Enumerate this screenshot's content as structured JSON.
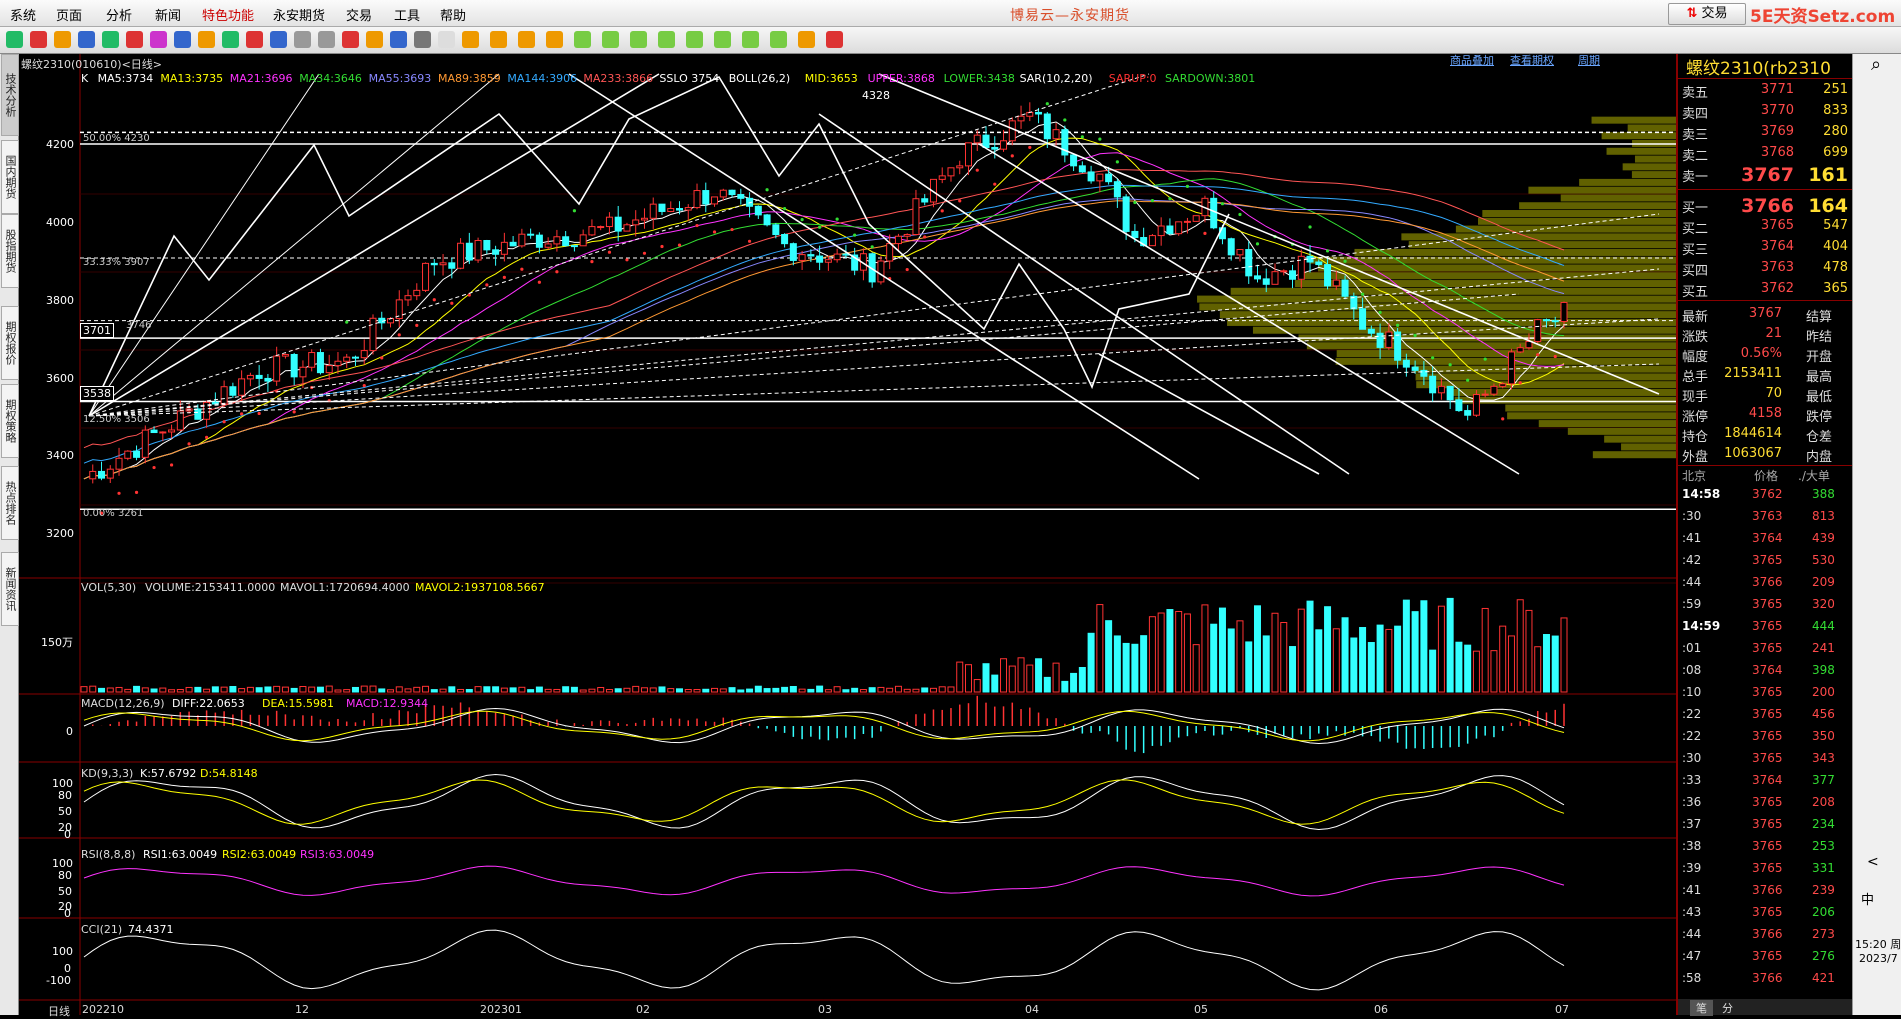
{
  "menu": {
    "items": [
      "系统",
      "页面",
      "分析",
      "新闻",
      "特色功能",
      "永安期货",
      "交易",
      "工具",
      "帮助"
    ],
    "brand": "博易云—永安期货",
    "trade_button": "交易",
    "site_logo": "5E天资Setz.com"
  },
  "chart_header": {
    "title": "螺纹2310(010610)<日线>",
    "links": [
      "商品叠加",
      "查看期权",
      "周期"
    ]
  },
  "main_indicators": [
    {
      "text": "K",
      "color": "#ffffff"
    },
    {
      "text": "MA5:3734",
      "color": "#ffffff"
    },
    {
      "text": "MA13:3735",
      "color": "#ffff00"
    },
    {
      "text": "MA21:3696",
      "color": "#ff33ff"
    },
    {
      "text": "MA34:3646",
      "color": "#33dd33"
    },
    {
      "text": "MA55:3693",
      "color": "#8888ff"
    },
    {
      "text": "MA89:3859",
      "color": "#ff9933"
    },
    {
      "text": "MA144:3906",
      "color": "#33aaff"
    },
    {
      "text": "MA233:3866",
      "color": "#ff5555"
    },
    {
      "text": "SSLO 3754",
      "color": "#ffffff"
    },
    {
      "text": "BOLL(26,2)",
      "color": "#ffffff"
    },
    {
      "text": "MID:3653",
      "color": "#ffff00"
    },
    {
      "text": "UPPER:3868",
      "color": "#ff33ff"
    },
    {
      "text": "LOWER:3438",
      "color": "#33dd33"
    },
    {
      "text": "SAR(10,2,20)",
      "color": "#ffffff"
    },
    {
      "text": "SARUP:0",
      "color": "#ff3333"
    },
    {
      "text": "SARDOWN:3801",
      "color": "#33dd33"
    }
  ],
  "price_axis": [
    "4200",
    "4000",
    "3800",
    "3600",
    "3400",
    "3200"
  ],
  "price_annotations": {
    "high": "4328",
    "fib_50": "50.00%  4230",
    "fib_33": "33.33%  3907",
    "fib_125": "12.50%  3506",
    "fib_0": "0.00%  3261",
    "line_3701": "3701",
    "line_3746": "3746",
    "line_3538": "3538"
  },
  "volume_panel": {
    "label_vol": "VOL(5,30)",
    "label_volume": "VOLUME:2153411.0000",
    "label_mavol1": "MAVOL1:1720694.4000",
    "label_mavol2": "MAVOL2:1937108.5667",
    "axis": "150万"
  },
  "macd_panel": {
    "label": "MACD(12,26,9)",
    "diff": "DIFF:22.0653",
    "dea": "DEA:15.5981",
    "macd": "MACD:12.9344",
    "axis": "0"
  },
  "kd_panel": {
    "label": "KD(9,3,3)",
    "k": "K:57.6792",
    "d": "D:54.8148",
    "axis": [
      "100",
      "80",
      "50",
      "20",
      "0"
    ]
  },
  "rsi_panel": {
    "label": "RSI(8,8,8)",
    "rsi1": "RSI1:63.0049",
    "rsi2": "RSI2:63.0049",
    "rsi3": "RSI3:63.0049",
    "axis": [
      "100",
      "80",
      "50",
      "20",
      "0"
    ]
  },
  "cci_panel": {
    "label": "CCI(21)",
    "value": "74.4371",
    "axis": [
      "100",
      "0",
      "-100"
    ]
  },
  "date_axis": [
    "日线",
    "202210",
    "12",
    "202301",
    "02",
    "03",
    "04",
    "05",
    "06",
    "07"
  ],
  "left_tabs": [
    "技术分析",
    "国内期货",
    "股指期货",
    "期权报价",
    "期权策略",
    "热点排名",
    "新闻资讯"
  ],
  "quote": {
    "symbol": "螺纹2310(rb2310",
    "asks": [
      {
        "label": "卖五",
        "price": "3771",
        "vol": "251"
      },
      {
        "label": "卖四",
        "price": "3770",
        "vol": "833"
      },
      {
        "label": "卖三",
        "price": "3769",
        "vol": "280"
      },
      {
        "label": "卖二",
        "price": "3768",
        "vol": "699"
      },
      {
        "label": "卖一",
        "price": "3767",
        "vol": "161"
      }
    ],
    "bids": [
      {
        "label": "买一",
        "price": "3766",
        "vol": "164"
      },
      {
        "label": "买二",
        "price": "3765",
        "vol": "547"
      },
      {
        "label": "买三",
        "price": "3764",
        "vol": "404"
      },
      {
        "label": "买四",
        "price": "3763",
        "vol": "478"
      },
      {
        "label": "买五",
        "price": "3762",
        "vol": "365"
      }
    ],
    "stats": [
      {
        "label": "最新",
        "value": "3767",
        "label2": "结算"
      },
      {
        "label": "涨跌",
        "value": "21",
        "label2": "昨结"
      },
      {
        "label": "幅度",
        "value": "0.56%",
        "label2": "开盘"
      },
      {
        "label": "总手",
        "value": "2153411",
        "label2": "最高"
      },
      {
        "label": "现手",
        "value": "70",
        "label2": "最低"
      },
      {
        "label": "涨停",
        "value": "4158",
        "label2": "跌停"
      },
      {
        "label": "持仓",
        "value": "1844614",
        "label2": "仓差"
      },
      {
        "label": "外盘",
        "value": "1063067",
        "label2": "内盘"
      }
    ],
    "tick_header": {
      "time": "北京",
      "price": "价格",
      "vol": "./大单"
    },
    "ticks": [
      {
        "t": "14:58",
        "p": "3762",
        "v": "388",
        "c": "#33dd33"
      },
      {
        "t": ":30",
        "p": "3763",
        "v": "813",
        "c": "#ff4a4a"
      },
      {
        "t": ":41",
        "p": "3764",
        "v": "439",
        "c": "#ff4a4a"
      },
      {
        "t": ":42",
        "p": "3765",
        "v": "530",
        "c": "#ff4a4a"
      },
      {
        "t": ":44",
        "p": "3766",
        "v": "209",
        "c": "#ff4a4a"
      },
      {
        "t": ":59",
        "p": "3765",
        "v": "320",
        "c": "#ff4a4a"
      },
      {
        "t": "14:59",
        "p": "3765",
        "v": "444",
        "c": "#33dd33"
      },
      {
        "t": ":01",
        "p": "3765",
        "v": "241",
        "c": "#ff4a4a"
      },
      {
        "t": ":08",
        "p": "3764",
        "v": "398",
        "c": "#33dd33"
      },
      {
        "t": ":10",
        "p": "3765",
        "v": "200",
        "c": "#ff4a4a"
      },
      {
        "t": ":22",
        "p": "3765",
        "v": "456",
        "c": "#ff4a4a"
      },
      {
        "t": ":22",
        "p": "3765",
        "v": "350",
        "c": "#ff4a4a"
      },
      {
        "t": ":30",
        "p": "3765",
        "v": "343",
        "c": "#ff4a4a"
      },
      {
        "t": ":33",
        "p": "3764",
        "v": "377",
        "c": "#33dd33"
      },
      {
        "t": ":36",
        "p": "3765",
        "v": "208",
        "c": "#ff4a4a"
      },
      {
        "t": ":37",
        "p": "3765",
        "v": "234",
        "c": "#33dd33"
      },
      {
        "t": ":38",
        "p": "3765",
        "v": "253",
        "c": "#33dd33"
      },
      {
        "t": ":39",
        "p": "3765",
        "v": "331",
        "c": "#33dd33"
      },
      {
        "t": ":41",
        "p": "3766",
        "v": "239",
        "c": "#ff4a4a"
      },
      {
        "t": ":43",
        "p": "3765",
        "v": "206",
        "c": "#33dd33"
      },
      {
        "t": ":44",
        "p": "3766",
        "v": "273",
        "c": "#ff4a4a"
      },
      {
        "t": ":47",
        "p": "3765",
        "v": "276",
        "c": "#33dd33"
      },
      {
        "t": ":58",
        "p": "3766",
        "v": "421",
        "c": "#ff4a4a"
      }
    ],
    "bottom_tabs": [
      "笔",
      "分"
    ]
  },
  "system_tray": {
    "input_method": "中",
    "time": "15:20 周",
    "date": "2023/7"
  }
}
